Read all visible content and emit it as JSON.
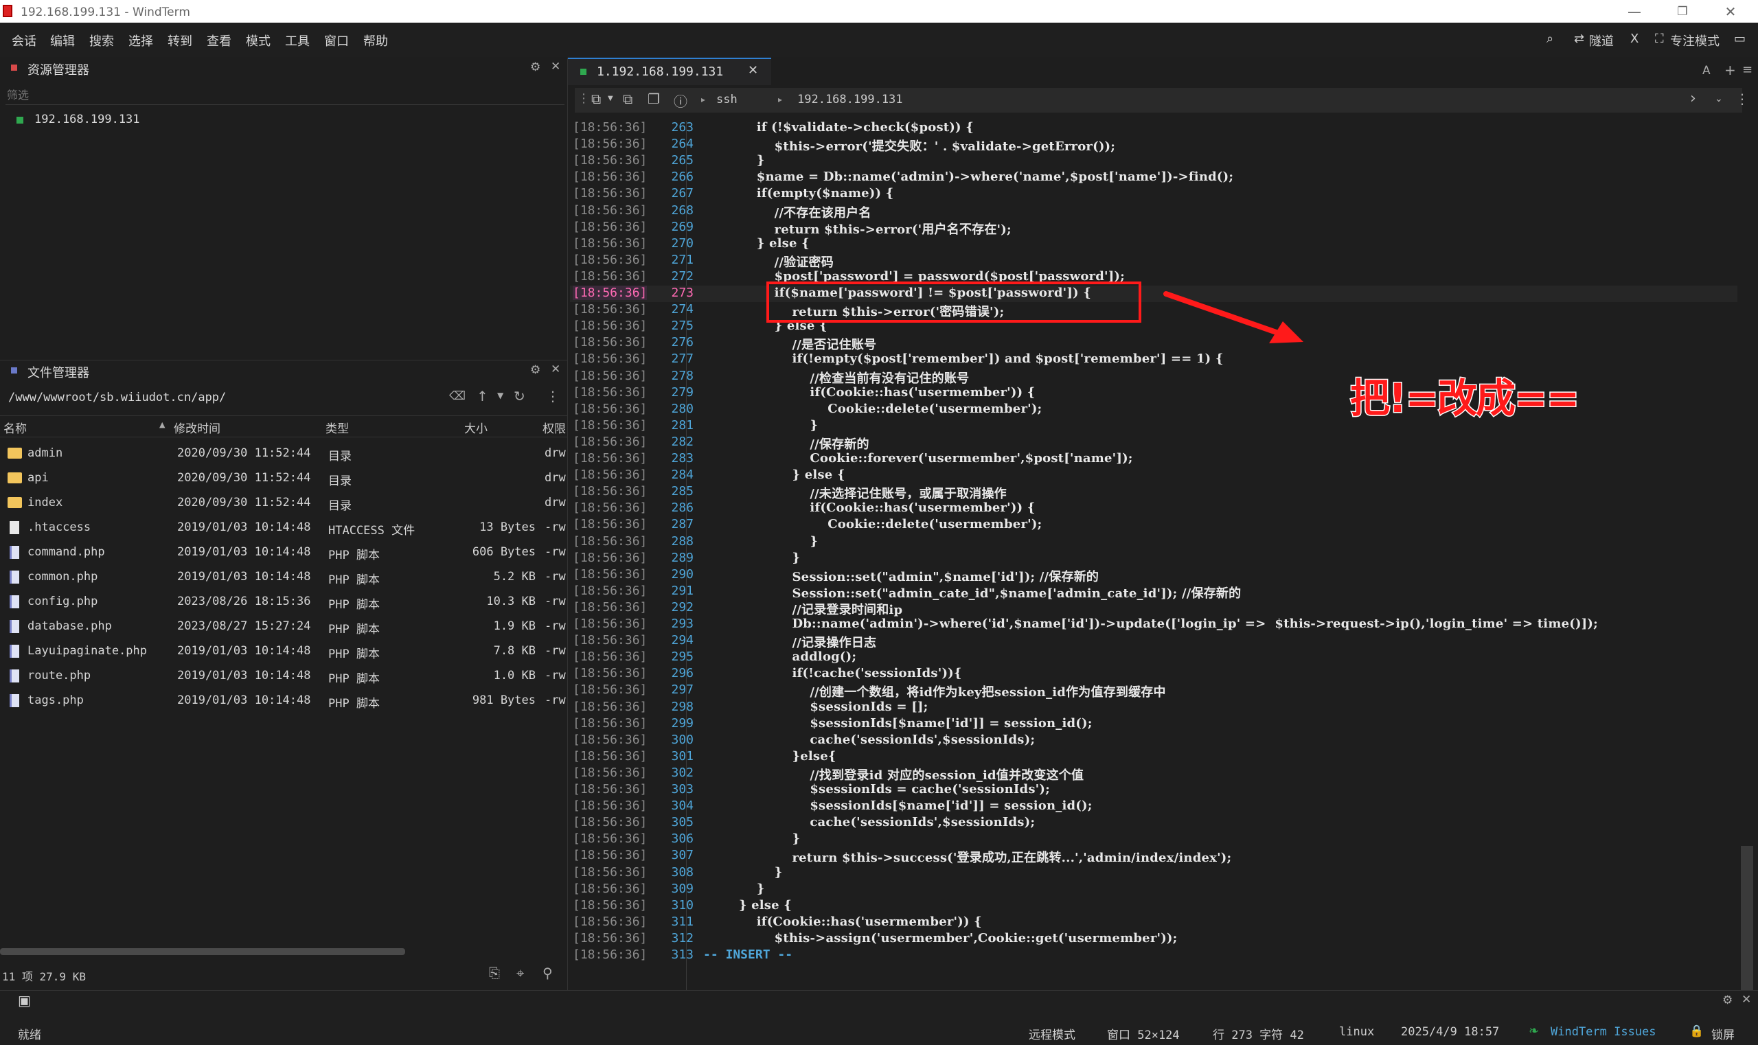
{
  "window": {
    "title": "192.168.199.131 - WindTerm",
    "minimize": "—",
    "maximize": "❐",
    "close": "✕"
  },
  "menu": [
    "会话",
    "编辑",
    "搜索",
    "选择",
    "转到",
    "查看",
    "模式",
    "工具",
    "窗口",
    "帮助"
  ],
  "toolbar_right": {
    "tunnel": "隧道",
    "x": "X",
    "focus": "专注模式"
  },
  "resource_panel": {
    "title": "资源管理器",
    "filter_placeholder": "筛选",
    "host": "192.168.199.131"
  },
  "file_panel": {
    "title": "文件管理器",
    "path": "/www/wwwroot/sb.wiiudot.cn/app/",
    "columns": [
      "名称",
      "修改时间",
      "类型",
      "大小",
      "权限"
    ],
    "files": [
      {
        "name": "admin",
        "mtime": "2020/09/30 11:52:44",
        "type": "目录",
        "size": "",
        "perm": "drw",
        "kind": "folder"
      },
      {
        "name": "api",
        "mtime": "2020/09/30 11:52:44",
        "type": "目录",
        "size": "",
        "perm": "drw",
        "kind": "folder"
      },
      {
        "name": "index",
        "mtime": "2020/09/30 11:52:44",
        "type": "目录",
        "size": "",
        "perm": "drw",
        "kind": "folder"
      },
      {
        "name": ".htaccess",
        "mtime": "2019/01/03 10:14:48",
        "type": "HTACCESS 文件",
        "size": "13 Bytes",
        "perm": "-rw",
        "kind": "file"
      },
      {
        "name": "command.php",
        "mtime": "2019/01/03 10:14:48",
        "type": "PHP 脚本",
        "size": "606 Bytes",
        "perm": "-rw",
        "kind": "php"
      },
      {
        "name": "common.php",
        "mtime": "2019/01/03 10:14:48",
        "type": "PHP 脚本",
        "size": "5.2 KB",
        "perm": "-rw",
        "kind": "php"
      },
      {
        "name": "config.php",
        "mtime": "2023/08/26 18:15:36",
        "type": "PHP 脚本",
        "size": "10.3 KB",
        "perm": "-rw",
        "kind": "php"
      },
      {
        "name": "database.php",
        "mtime": "2023/08/27 15:27:24",
        "type": "PHP 脚本",
        "size": "1.9 KB",
        "perm": "-rw",
        "kind": "php"
      },
      {
        "name": "Layuipaginate.php",
        "mtime": "2019/01/03 10:14:48",
        "type": "PHP 脚本",
        "size": "7.8 KB",
        "perm": "-rw",
        "kind": "php"
      },
      {
        "name": "route.php",
        "mtime": "2019/01/03 10:14:48",
        "type": "PHP 脚本",
        "size": "1.0 KB",
        "perm": "-rw",
        "kind": "php"
      },
      {
        "name": "tags.php",
        "mtime": "2019/01/03 10:14:48",
        "type": "PHP 脚本",
        "size": "981 Bytes",
        "perm": "-rw",
        "kind": "php"
      }
    ],
    "summary": "11 项 27.9 KB"
  },
  "terminal": {
    "tab_label": "1.192.168.199.131",
    "protocol": "ssh",
    "host": "192.168.199.131",
    "timestamp": "[18:56:36]",
    "current_line": 273,
    "mode_line": "-- INSERT --",
    "lines": [
      {
        "n": 263,
        "t": "        if (!$validate->check($post)) {"
      },
      {
        "n": 264,
        "t": "            $this->error('提交失败：' . $validate->getError());"
      },
      {
        "n": 265,
        "t": "        }"
      },
      {
        "n": 266,
        "t": "        $name = Db::name('admin')->where('name',$post['name'])->find();"
      },
      {
        "n": 267,
        "t": "        if(empty($name)) {"
      },
      {
        "n": 268,
        "t": "            //不存在该用户名"
      },
      {
        "n": 269,
        "t": "            return $this->error('用户名不存在');"
      },
      {
        "n": 270,
        "t": "        } else {"
      },
      {
        "n": 271,
        "t": "            //验证密码"
      },
      {
        "n": 272,
        "t": "            $post['password'] = password($post['password']);"
      },
      {
        "n": 273,
        "t": "            if($name['password'] != $post['password']) {"
      },
      {
        "n": 274,
        "t": "                return $this->error('密码错误');"
      },
      {
        "n": 275,
        "t": "            } else {"
      },
      {
        "n": 276,
        "t": "                //是否记住账号"
      },
      {
        "n": 277,
        "t": "                if(!empty($post['remember']) and $post['remember'] == 1) {"
      },
      {
        "n": 278,
        "t": "                    //检查当前有没有记住的账号"
      },
      {
        "n": 279,
        "t": "                    if(Cookie::has('usermember')) {"
      },
      {
        "n": 280,
        "t": "                        Cookie::delete('usermember');"
      },
      {
        "n": 281,
        "t": "                    }"
      },
      {
        "n": 282,
        "t": "                    //保存新的"
      },
      {
        "n": 283,
        "t": "                    Cookie::forever('usermember',$post['name']);"
      },
      {
        "n": 284,
        "t": "                } else {"
      },
      {
        "n": 285,
        "t": "                    //未选择记住账号，或属于取消操作"
      },
      {
        "n": 286,
        "t": "                    if(Cookie::has('usermember')) {"
      },
      {
        "n": 287,
        "t": "                        Cookie::delete('usermember');"
      },
      {
        "n": 288,
        "t": "                    }"
      },
      {
        "n": 289,
        "t": "                }"
      },
      {
        "n": 290,
        "t": "                Session::set(\"admin\",$name['id']); //保存新的"
      },
      {
        "n": 291,
        "t": "                Session::set(\"admin_cate_id\",$name['admin_cate_id']); //保存新的"
      },
      {
        "n": 292,
        "t": "                //记录登录时间和ip"
      },
      {
        "n": 293,
        "t": "                Db::name('admin')->where('id',$name['id'])->update(['login_ip' =>  $this->request->ip(),'login_time' => time()]);"
      },
      {
        "n": 294,
        "t": "                //记录操作日志"
      },
      {
        "n": 295,
        "t": "                addlog();"
      },
      {
        "n": 296,
        "t": "                if(!cache('sessionIds')){"
      },
      {
        "n": 297,
        "t": "                    //创建一个数组，将id作为key把session_id作为值存到缓存中"
      },
      {
        "n": 298,
        "t": "                    $sessionIds = [];"
      },
      {
        "n": 299,
        "t": "                    $sessionIds[$name['id']] = session_id();"
      },
      {
        "n": 300,
        "t": "                    cache('sessionIds',$sessionIds);"
      },
      {
        "n": 301,
        "t": "                }else{"
      },
      {
        "n": 302,
        "t": "                    //找到登录id 对应的session_id值并改变这个值"
      },
      {
        "n": 303,
        "t": "                    $sessionIds = cache('sessionIds');"
      },
      {
        "n": 304,
        "t": "                    $sessionIds[$name['id']] = session_id();"
      },
      {
        "n": 305,
        "t": "                    cache('sessionIds',$sessionIds);"
      },
      {
        "n": 306,
        "t": "                }"
      },
      {
        "n": 307,
        "t": "                return $this->success('登录成功,正在跳转...','admin/index/index');"
      },
      {
        "n": 308,
        "t": "            }"
      },
      {
        "n": 309,
        "t": "        }"
      },
      {
        "n": 310,
        "t": "    } else {"
      },
      {
        "n": 311,
        "t": "        if(Cookie::has('usermember')) {"
      },
      {
        "n": 312,
        "t": "            $this->assign('usermember',Cookie::get('usermember'));"
      },
      {
        "n": 313,
        "t": ""
      }
    ]
  },
  "annotation": "把!=改成==",
  "status": {
    "ready": "就绪",
    "remote_mode": "远程模式",
    "window_size": "窗口 52×124",
    "cursor_pos": "行 273 字符 42",
    "os": "linux",
    "datetime": "2025/4/9 18:57",
    "issues": "WindTerm Issues",
    "lock": "锁屏"
  },
  "colors": {
    "accent": "#2fa84f",
    "annotation": "#ff1a1a",
    "line_number": "#4fa6d9",
    "timestamp": "#8c8c8c"
  }
}
